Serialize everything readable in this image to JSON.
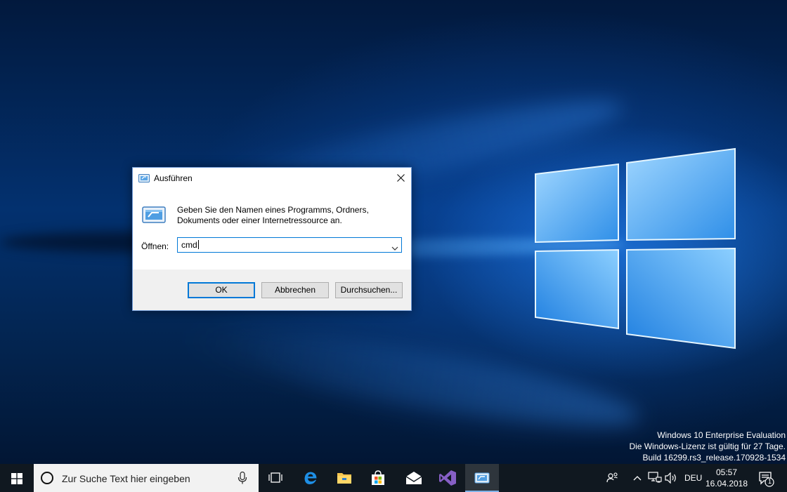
{
  "desktop": {
    "watermark": {
      "line1": "Windows 10 Enterprise Evaluation",
      "line2": "Die Windows-Lizenz ist gültig für 27 Tage.",
      "line3": "Build 16299.rs3_release.170928-1534"
    }
  },
  "dialog": {
    "title": "Ausführen",
    "description_line1": "Geben Sie den Namen eines Programms, Ordners,",
    "description_line2": "Dokuments oder einer Internetressource an.",
    "open_label": "Öffnen:",
    "open_value": "cmd",
    "buttons": {
      "ok": "OK",
      "cancel": "Abbrechen",
      "browse": "Durchsuchen..."
    }
  },
  "taskbar": {
    "search_placeholder": "Zur Suche Text hier eingeben",
    "pinned": [
      "task-view",
      "edge",
      "file-explorer",
      "store",
      "mail",
      "visual-studio",
      "run"
    ],
    "tray": {
      "language": "DEU",
      "time": "05:57",
      "date": "16.04.2018",
      "notification_count": "1"
    }
  },
  "colors": {
    "accent": "#0078d7",
    "taskbar": "#101820",
    "dialog_footer": "#f0f0f0"
  }
}
